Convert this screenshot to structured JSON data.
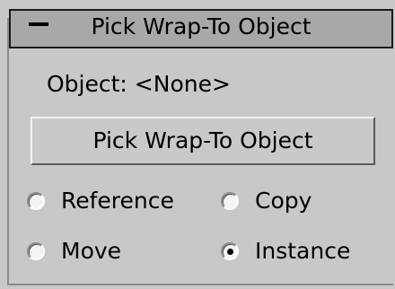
{
  "rollout": {
    "toggle_symbol": "-",
    "title": "Pick Wrap-To Object"
  },
  "object_field": {
    "label": "Object: <None>"
  },
  "pick_button": {
    "label": "Pick Wrap-To Object"
  },
  "options": [
    {
      "label": "Reference",
      "checked": false
    },
    {
      "label": "Copy",
      "checked": false
    },
    {
      "label": "Move",
      "checked": false
    },
    {
      "label": "Instance",
      "checked": true
    }
  ]
}
